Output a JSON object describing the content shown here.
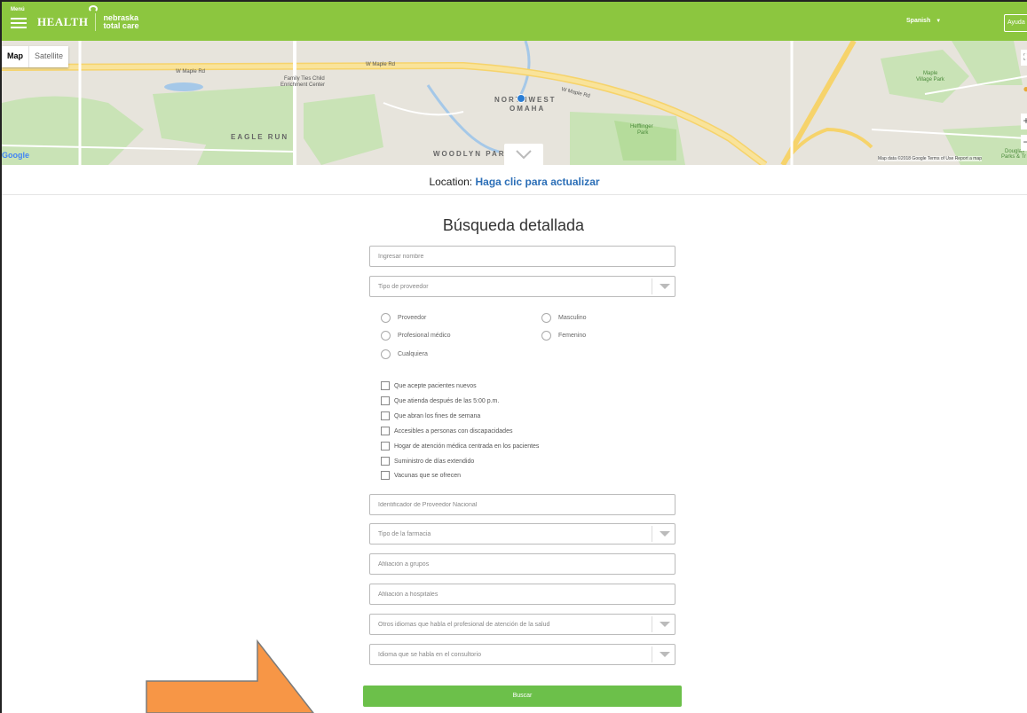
{
  "header": {
    "menu_label": "Menú",
    "logo_health": "HEALTH",
    "logo_ntc_line1": "nebraska",
    "logo_ntc_line2": "total care",
    "language": "Spanish",
    "help_label": "Ayuda",
    "brand_color": "#8cc63f"
  },
  "map": {
    "type_map": "Map",
    "type_satellite": "Satellite",
    "labels": {
      "w_maple_rd_1": "W Maple Rd",
      "w_maple_rd_2": "W Maple Rd",
      "w_maple_rd_3": "W Maple Rd",
      "family_ties": "Family Ties Child",
      "family_ties_2": "Enrichment Center",
      "northwest": "NORTHWEST",
      "omaha": "OMAHA",
      "eagle_run": "EAGLE RUN",
      "woodlyn_park": "WOODLYN PAR",
      "maple_village": "Maple",
      "maple_village_2": "Village Park",
      "hefflinger": "Hefflinger",
      "hefflinger_2": "Park",
      "douglas": "Douglas",
      "douglas_2": "Parks & Tr"
    },
    "google": "Google",
    "attribution": "Map data ©2018 Google   Terms of Use   Report a map"
  },
  "location": {
    "label": "Location:",
    "link": "Haga clic para actualizar"
  },
  "form": {
    "title": "Búsqueda detallada",
    "name_placeholder": "Ingresar nombre",
    "provider_type": "Tipo de proveedor",
    "radios": {
      "provider": "Proveedor",
      "professional": "Profesional médico",
      "any": "Cualquiera",
      "male": "Masculino",
      "female": "Femenino"
    },
    "checks": [
      "Que acepte pacientes nuevos",
      "Que atienda después de las 5:00 p.m.",
      "Que abran los fines de semana",
      "Accesibles a personas con discapacidades",
      "Hogar de atención médica centrada en los pacientes",
      "Suministro de días extendido",
      "Vacunas que se ofrecen"
    ],
    "npi_placeholder": "Identificador de Proveedor Nacional",
    "pharmacy_type": "Tipo de la farmacia",
    "group_placeholder": "Afiliación a grupos",
    "hospital_placeholder": "Afiliación a hospitales",
    "other_languages": "Otros idiomas que habla el profesional de atención de la salud",
    "office_language": "Idioma que se habla en el consultorio",
    "search_label": "Buscar"
  },
  "colors": {
    "accent_green": "#6cc04a",
    "link_blue": "#2c6fb7",
    "annotation_arrow": "#f79646"
  }
}
